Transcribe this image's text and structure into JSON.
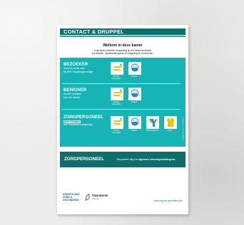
{
  "poster": {
    "title": "CONTACT & DRUPPEL",
    "welcome": "Welkom in deze kamer",
    "intro_line1": "Volg deze adviezen zorgvuldig op om kiemoverdracht",
    "intro_line2": "via handen, speekseldruppels of omgeving te voorkomen."
  },
  "sections": [
    {
      "name": "BEZOEKER",
      "desc_line1": "meld je eerst aan",
      "desc_line2": "bij een verpleegkundige",
      "items": [
        {
          "icon": "hand-disinfection-icon",
          "caption": "handen ontsmetten"
        },
        {
          "icon": "mask-icon",
          "caption": "masker"
        }
      ]
    },
    {
      "name": "BEWONER",
      "desc_line1": "bij het verlaten",
      "desc_line2": "van de kamer",
      "items": [
        {
          "icon": "hand-disinfection-icon",
          "caption": "handen ontsmetten"
        },
        {
          "icon": "mask-icon",
          "caption": "masker"
        }
      ]
    },
    {
      "name": "ZORGPERSONEEL",
      "highlight": "met contact",
      "desc_line2": "met bewoner/omgeving",
      "items": [
        {
          "icon": "hand-disinfection-icon",
          "caption": "handen ontsmetten"
        },
        {
          "icon": "mask-icon",
          "caption": "masker"
        },
        {
          "icon": "gloves-icon",
          "caption": "handschoenen"
        },
        {
          "icon": "gown-icon",
          "caption": "schort"
        }
      ]
    }
  ],
  "side_label": "© Agentschap Zorg en Gezondheid",
  "dark_band": {
    "title": "ZORGPERSONEEL",
    "text_prefix": "Respecteer altijd de",
    "text_bold": "algemene voorzorgsmaatregelen"
  },
  "footer": {
    "agency_line1": "AGENTSCHAP",
    "agency_line2": "ZORG &",
    "agency_line3": "GEZONDHEID",
    "vl_name": "Vlaanderen",
    "vl_sub": "is zorg",
    "website": "www.zorg-en-gezondheid.be"
  },
  "colors": {
    "teal": "#17b4b6",
    "dark_teal": "#0e6e6b",
    "icon_yellow": "#f5c400",
    "icon_blue": "#1e8fc9"
  }
}
